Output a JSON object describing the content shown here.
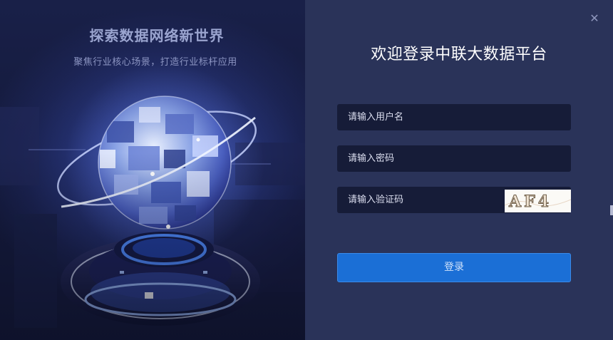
{
  "left": {
    "headline": "探索数据网络新世界",
    "tagline": "聚焦行业核心场景，打造行业标杆应用"
  },
  "login": {
    "title": "欢迎登录中联大数据平台",
    "username_placeholder": "请输入用户名",
    "password_placeholder": "请输入密码",
    "captcha_placeholder": "请输入验证码",
    "captcha_text": "AF4",
    "submit_label": "登录",
    "close_icon": "close-icon"
  },
  "colors": {
    "panel_bg": "#2a3359",
    "input_bg": "#161c38",
    "button_bg": "#1b6fd6",
    "title_text": "#ffffff"
  }
}
